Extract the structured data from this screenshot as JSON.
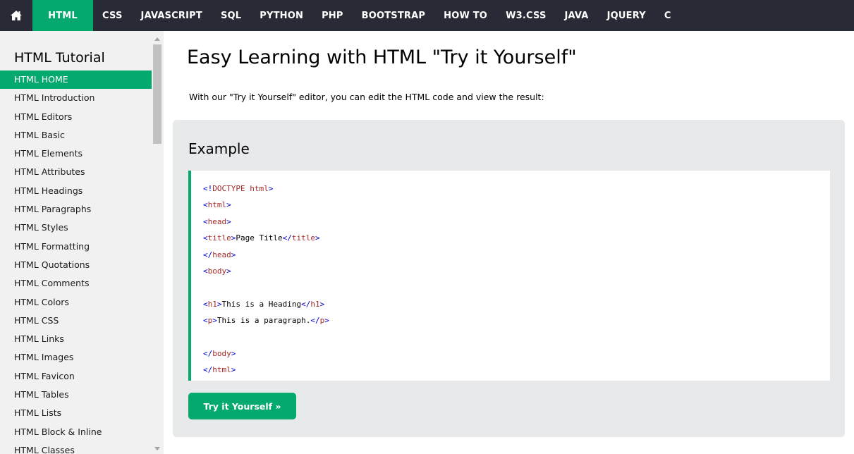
{
  "topnav": {
    "home_icon": "home-icon",
    "items": [
      {
        "label": "HTML",
        "active": true
      },
      {
        "label": "CSS"
      },
      {
        "label": "JAVASCRIPT"
      },
      {
        "label": "SQL"
      },
      {
        "label": "PYTHON"
      },
      {
        "label": "PHP"
      },
      {
        "label": "BOOTSTRAP"
      },
      {
        "label": "HOW TO"
      },
      {
        "label": "W3.CSS"
      },
      {
        "label": "JAVA"
      },
      {
        "label": "JQUERY"
      },
      {
        "label": "C"
      }
    ]
  },
  "sidebar": {
    "title": "HTML Tutorial",
    "items": [
      "HTML HOME",
      "HTML Introduction",
      "HTML Editors",
      "HTML Basic",
      "HTML Elements",
      "HTML Attributes",
      "HTML Headings",
      "HTML Paragraphs",
      "HTML Styles",
      "HTML Formatting",
      "HTML Quotations",
      "HTML Comments",
      "HTML Colors",
      "HTML CSS",
      "HTML Links",
      "HTML Images",
      "HTML Favicon",
      "HTML Tables",
      "HTML Lists",
      "HTML Block & Inline",
      "HTML Classes"
    ],
    "active_index": 0
  },
  "main": {
    "title": "Easy Learning with HTML \"Try it Yourself\"",
    "intro": "With our \"Try it Yourself\" editor, you can edit the HTML code and view the result:",
    "example": {
      "heading": "Example",
      "code_lines": [
        {
          "open": "<!",
          "tag": "DOCTYPE",
          "attr": " html",
          "close": ">"
        },
        {
          "open": "<",
          "tag": "html",
          "close": ">"
        },
        {
          "open": "<",
          "tag": "head",
          "close": ">"
        },
        {
          "open": "<",
          "tag": "title",
          "close": ">",
          "text": "Page Title",
          "end_open": "</",
          "end_tag": "title",
          "end_close": ">"
        },
        {
          "open": "</",
          "tag": "head",
          "close": ">"
        },
        {
          "open": "<",
          "tag": "body",
          "close": ">"
        },
        {
          "blank": true
        },
        {
          "open": "<",
          "tag": "h1",
          "close": ">",
          "text": "This is a Heading",
          "end_open": "</",
          "end_tag": "h1",
          "end_close": ">"
        },
        {
          "open": "<",
          "tag": "p",
          "close": ">",
          "text": "This is a paragraph.",
          "end_open": "</",
          "end_tag": "p",
          "end_close": ">"
        },
        {
          "blank": true
        },
        {
          "open": "</",
          "tag": "body",
          "close": ">"
        },
        {
          "open": "</",
          "tag": "html",
          "close": ">"
        }
      ],
      "button_label": "Try it Yourself »"
    }
  },
  "colors": {
    "nav_bg": "#282a35",
    "accent": "#04aa6d",
    "sidebar_bg": "#f1f1f1",
    "example_bg": "#e7e9eb",
    "code_tag": "#a52a2a",
    "code_bracket": "#0000cd"
  }
}
